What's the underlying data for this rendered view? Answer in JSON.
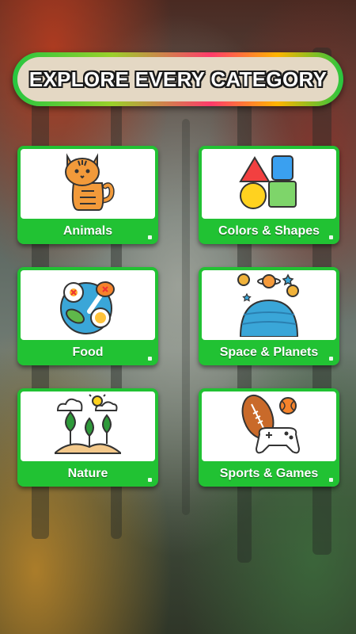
{
  "header": {
    "title": "EXPLORE EVERY CATEGORY"
  },
  "categories": [
    {
      "label": "Animals",
      "icon": "cat-icon"
    },
    {
      "label": "Colors & Shapes",
      "icon": "shapes-icon"
    },
    {
      "label": "Food",
      "icon": "food-plate-icon"
    },
    {
      "label": "Space & Planets",
      "icon": "planets-icon"
    },
    {
      "label": "Nature",
      "icon": "plants-icon"
    },
    {
      "label": "Sports & Games",
      "icon": "sports-gamepad-icon"
    }
  ],
  "colors": {
    "card": "#21c233",
    "header_fill": "#e4d8c4"
  }
}
